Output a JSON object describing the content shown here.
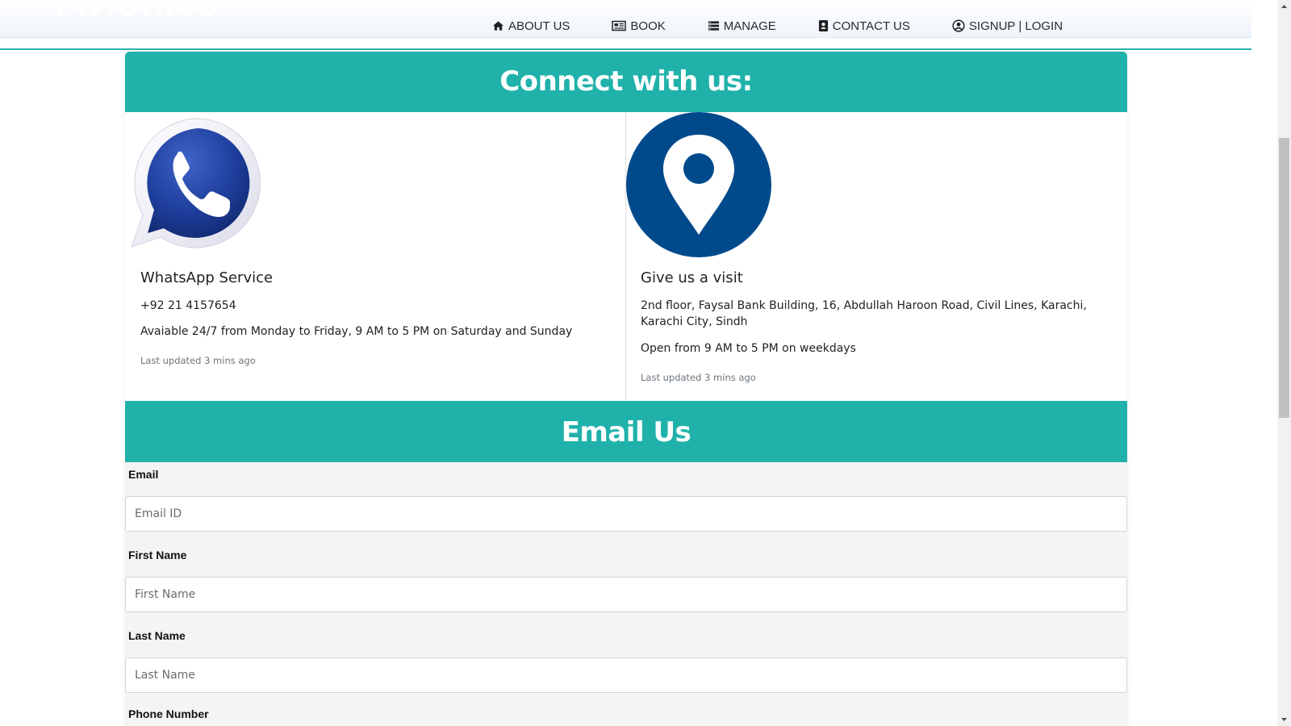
{
  "header": {
    "brand": "Avionics",
    "nav": [
      {
        "label": "ABOUT US",
        "icon": "home-icon"
      },
      {
        "label": "BOOK",
        "icon": "newspaper-icon"
      },
      {
        "label": "MANAGE",
        "icon": "list-icon"
      },
      {
        "label": "CONTACT US",
        "icon": "address-book-icon"
      },
      {
        "label": "SIGNUP | LOGIN",
        "icon": "user-circle-icon"
      }
    ]
  },
  "connect": {
    "heading": "Connect with us:",
    "whatsapp": {
      "title": "WhatsApp Service",
      "phone": "+92 21 4157654",
      "availability": "Avaiable 24/7 from Monday to Friday, 9 AM to 5 PM on Saturday and Sunday",
      "updated": "Last updated 3 mins ago",
      "icon": "whatsapp-icon"
    },
    "visit": {
      "title": "Give us a visit",
      "address": "2nd floor, Faysal Bank Building, 16, Abdullah Haroon Road, Civil Lines, Karachi, Karachi City, Sindh",
      "hours": "Open from 9 AM to 5 PM on weekdays",
      "updated": "Last updated 3 mins ago",
      "icon": "map-pin-icon"
    }
  },
  "email_form": {
    "heading": "Email Us",
    "fields": [
      {
        "label": "Email",
        "placeholder": "Email ID",
        "value": ""
      },
      {
        "label": "First Name",
        "placeholder": "First Name",
        "value": ""
      },
      {
        "label": "Last Name",
        "placeholder": "Last Name",
        "value": ""
      },
      {
        "label": "Phone Number"
      }
    ]
  },
  "colors": {
    "accent": "#20b2aa",
    "pin_blue": "#004a8c",
    "whatsapp_blue": "#1f3f9e"
  }
}
